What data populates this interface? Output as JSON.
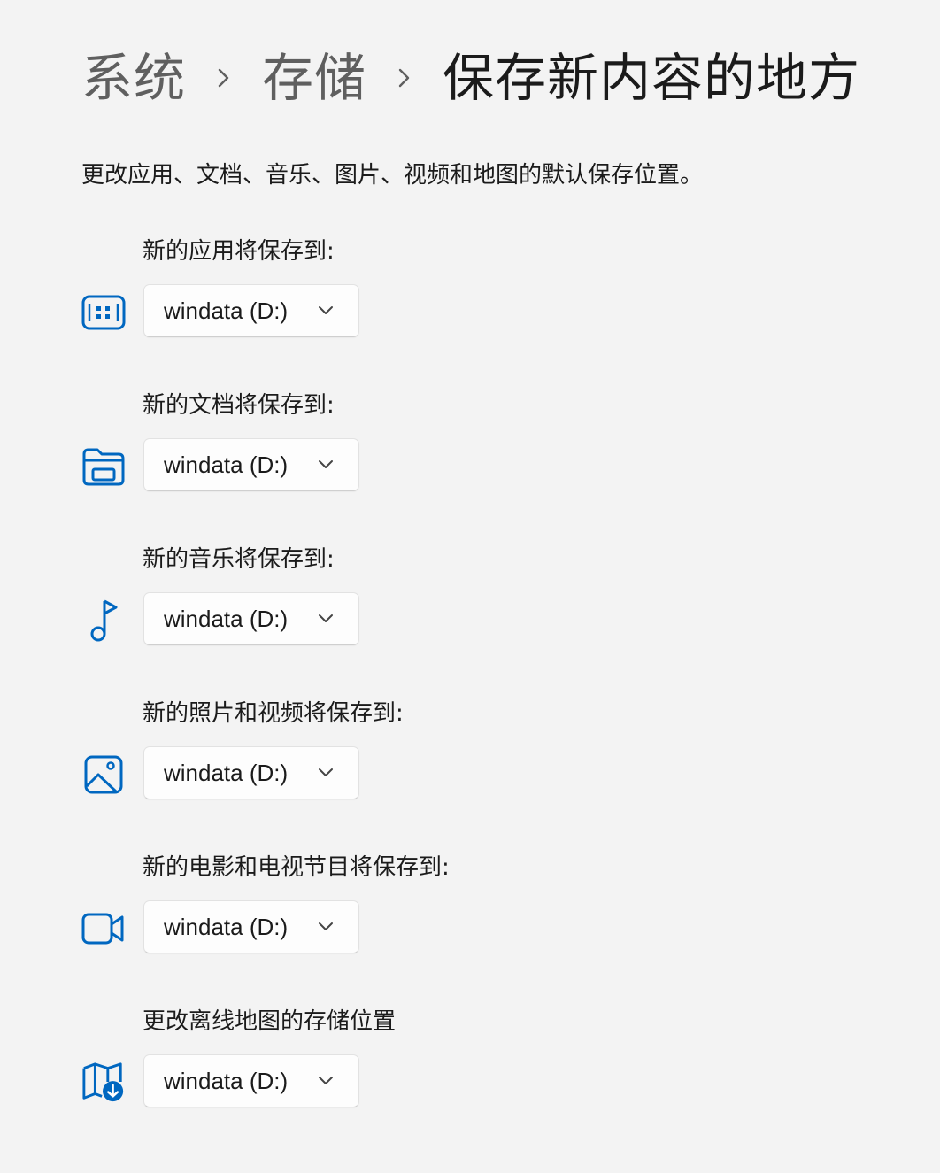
{
  "breadcrumb": {
    "items": [
      "系统",
      "存储"
    ],
    "current": "保存新内容的地方"
  },
  "description": "更改应用、文档、音乐、图片、视频和地图的默认保存位置。",
  "accent_color": "#0067c0",
  "settings": [
    {
      "label": "新的应用将保存到:",
      "icon": "apps-icon",
      "value": "windata (D:)"
    },
    {
      "label": "新的文档将保存到:",
      "icon": "documents-folder-icon",
      "value": "windata (D:)"
    },
    {
      "label": "新的音乐将保存到:",
      "icon": "music-note-icon",
      "value": "windata (D:)"
    },
    {
      "label": "新的照片和视频将保存到:",
      "icon": "picture-icon",
      "value": "windata (D:)"
    },
    {
      "label": "新的电影和电视节目将保存到:",
      "icon": "video-camera-icon",
      "value": "windata (D:)"
    },
    {
      "label": "更改离线地图的存储位置",
      "icon": "offline-map-icon",
      "value": "windata (D:)"
    }
  ]
}
